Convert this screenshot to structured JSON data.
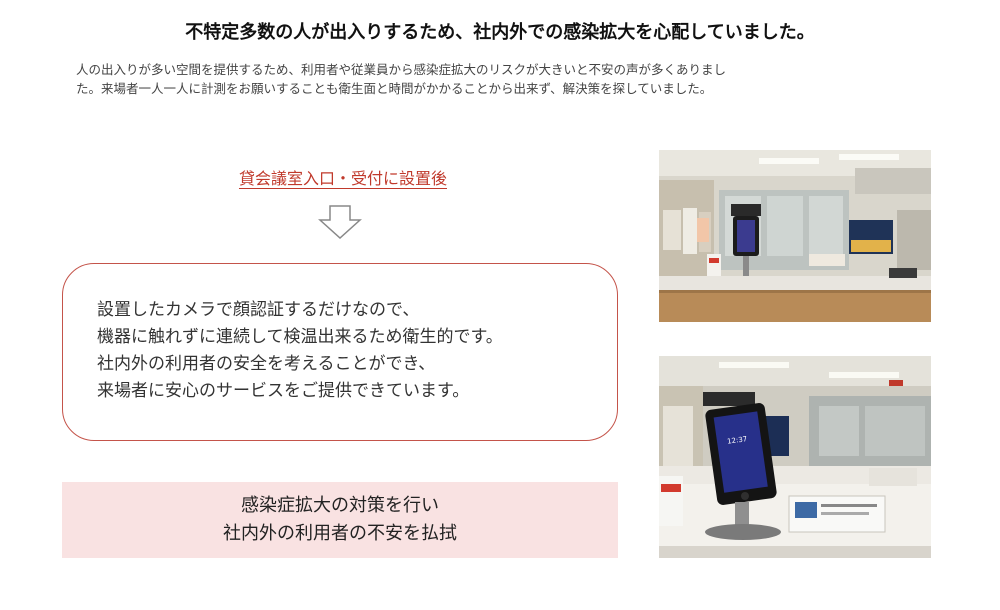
{
  "title": "不特定多数の人が出入りするため、社内外での感染拡大を心配していました。",
  "intro": {
    "line1": "人の出入りが多い空間を提供するため、利用者や従業員から感染症拡大のリスクが大きいと不安の声が多くありまし",
    "line2": "た。来場者一人一人に計測をお願いすることも衛生面と時間がかかることから出来ず、解決策を探していました。"
  },
  "placement_label": "貸会議室入口・受付に設置後",
  "message": {
    "line1": "設置したカメラで顔認証するだけなので、",
    "line2": "機器に触れずに連続して検温出来るため衛生的です。",
    "line3": "社内外の利用者の安全を考えることができ、",
    "line4": "来場者に安心のサービスをご提供できています。"
  },
  "result": {
    "line1": "感染症拡大の対策を行い",
    "line2": "社内外の利用者の不安を払拭"
  },
  "device_screen": {
    "time": "12:37"
  },
  "colors": {
    "accent_red": "#c0392b",
    "box_border": "#c4544a",
    "result_bg": "#f9e2e2"
  }
}
